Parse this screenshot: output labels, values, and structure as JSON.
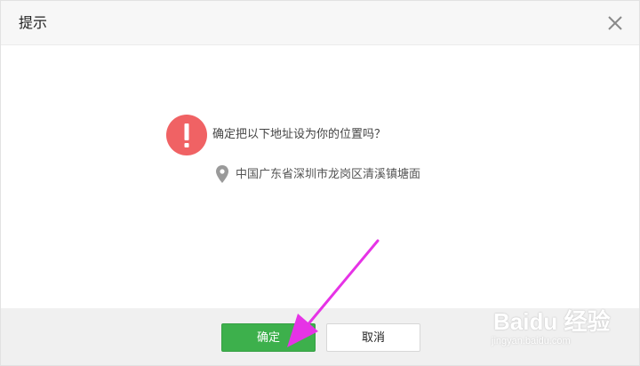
{
  "dialog": {
    "title": "提示",
    "question": "确定把以下地址设为你的位置吗？",
    "address": "中国广东省深圳市龙岗区清溪镇塘面",
    "icons": {
      "close": "close-icon",
      "warning": "exclamation-icon",
      "location": "map-pin-icon"
    }
  },
  "buttons": {
    "confirm_label": "确定",
    "cancel_label": "取消"
  },
  "watermark": {
    "brand": "Baidu 经验",
    "url": "jingyan.baidu.com"
  },
  "colors": {
    "warning": "#f06264",
    "confirm": "#3db04c",
    "annotation_arrow": "#e633e6"
  }
}
